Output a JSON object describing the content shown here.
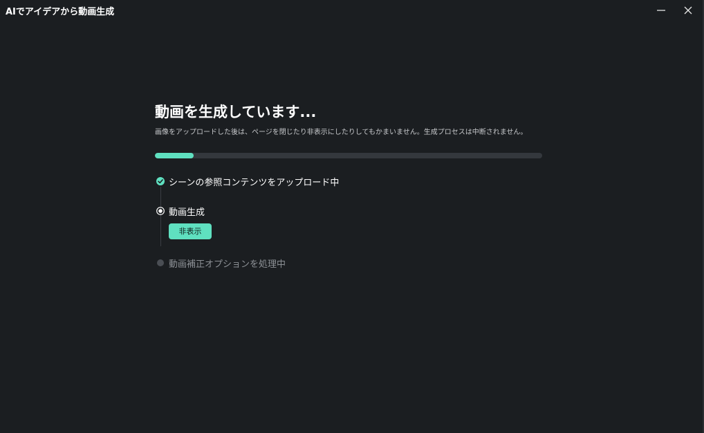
{
  "window": {
    "title": "AIでアイデアから動画生成"
  },
  "main": {
    "heading": "動画を生成しています...",
    "subtext": "画像をアップロードした後は、ページを閉じたり非表示にしたりしてもかまいません。生成プロセスは中断されません。",
    "progress": 0.1
  },
  "steps": [
    {
      "label": "シーンの参照コンテンツをアップロード中",
      "status": "done",
      "icon": "check-circle-icon"
    },
    {
      "label": "動画生成",
      "status": "active",
      "icon": "radio-active-icon"
    },
    {
      "label": "動画補正オプションを処理中",
      "status": "pending",
      "icon": "pending-dot-icon"
    }
  ],
  "buttons": {
    "hide_label": "非表示"
  },
  "colors": {
    "accent": "#5fe0c0",
    "background": "#1b1e21",
    "track": "#34383d",
    "pending_text": "#8d9196"
  }
}
